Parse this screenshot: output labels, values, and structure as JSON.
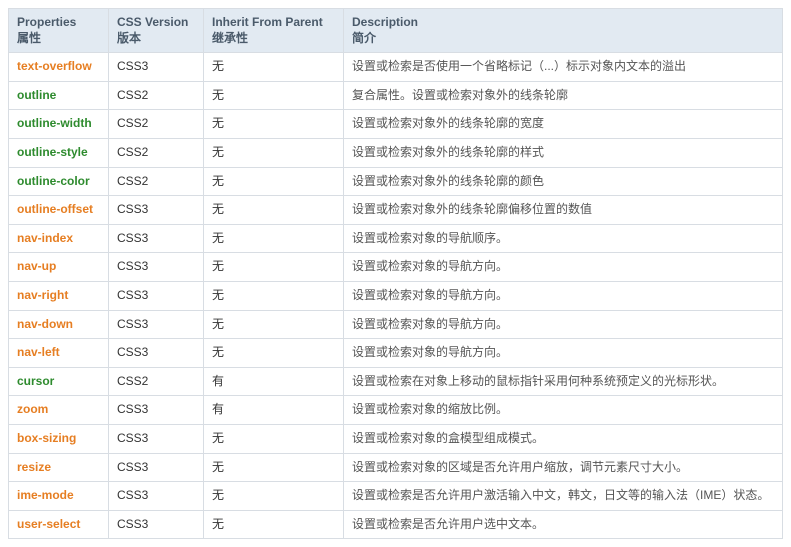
{
  "headers": {
    "col1_en": "Properties",
    "col1_zh": "属性",
    "col2_en": "CSS Version",
    "col2_zh": "版本",
    "col3_en": "Inherit From Parent",
    "col3_zh": "继承性",
    "col4_en": "Description",
    "col4_zh": "简介"
  },
  "rows": [
    {
      "prop": "text-overflow",
      "ver": "CSS3",
      "inh": "无",
      "desc": "设置或检索是否使用一个省略标记（...）标示对象内文本的溢出"
    },
    {
      "prop": "outline",
      "ver": "CSS2",
      "inh": "无",
      "desc": "复合属性。设置或检索对象外的线条轮廓"
    },
    {
      "prop": "outline-width",
      "ver": "CSS2",
      "inh": "无",
      "desc": "设置或检索对象外的线条轮廓的宽度"
    },
    {
      "prop": "outline-style",
      "ver": "CSS2",
      "inh": "无",
      "desc": "设置或检索对象外的线条轮廓的样式"
    },
    {
      "prop": "outline-color",
      "ver": "CSS2",
      "inh": "无",
      "desc": "设置或检索对象外的线条轮廓的颜色"
    },
    {
      "prop": "outline-offset",
      "ver": "CSS3",
      "inh": "无",
      "desc": "设置或检索对象外的线条轮廓偏移位置的数值"
    },
    {
      "prop": "nav-index",
      "ver": "CSS3",
      "inh": "无",
      "desc": "设置或检索对象的导航顺序。"
    },
    {
      "prop": "nav-up",
      "ver": "CSS3",
      "inh": "无",
      "desc": "设置或检索对象的导航方向。"
    },
    {
      "prop": "nav-right",
      "ver": "CSS3",
      "inh": "无",
      "desc": "设置或检索对象的导航方向。"
    },
    {
      "prop": "nav-down",
      "ver": "CSS3",
      "inh": "无",
      "desc": "设置或检索对象的导航方向。"
    },
    {
      "prop": "nav-left",
      "ver": "CSS3",
      "inh": "无",
      "desc": "设置或检索对象的导航方向。"
    },
    {
      "prop": "cursor",
      "ver": "CSS2",
      "inh": "有",
      "desc": "设置或检索在对象上移动的鼠标指针采用何种系统预定义的光标形状。"
    },
    {
      "prop": "zoom",
      "ver": "CSS3",
      "inh": "有",
      "desc": "设置或检索对象的缩放比例。"
    },
    {
      "prop": "box-sizing",
      "ver": "CSS3",
      "inh": "无",
      "desc": "设置或检索对象的盒模型组成模式。"
    },
    {
      "prop": "resize",
      "ver": "CSS3",
      "inh": "无",
      "desc": "设置或检索对象的区域是否允许用户缩放，调节元素尺寸大小。"
    },
    {
      "prop": "ime-mode",
      "ver": "CSS3",
      "inh": "无",
      "desc": "设置或检索是否允许用户激活输入中文，韩文，日文等的输入法（IME）状态。"
    },
    {
      "prop": "user-select",
      "ver": "CSS3",
      "inh": "无",
      "desc": "设置或检索是否允许用户选中文本。"
    }
  ]
}
